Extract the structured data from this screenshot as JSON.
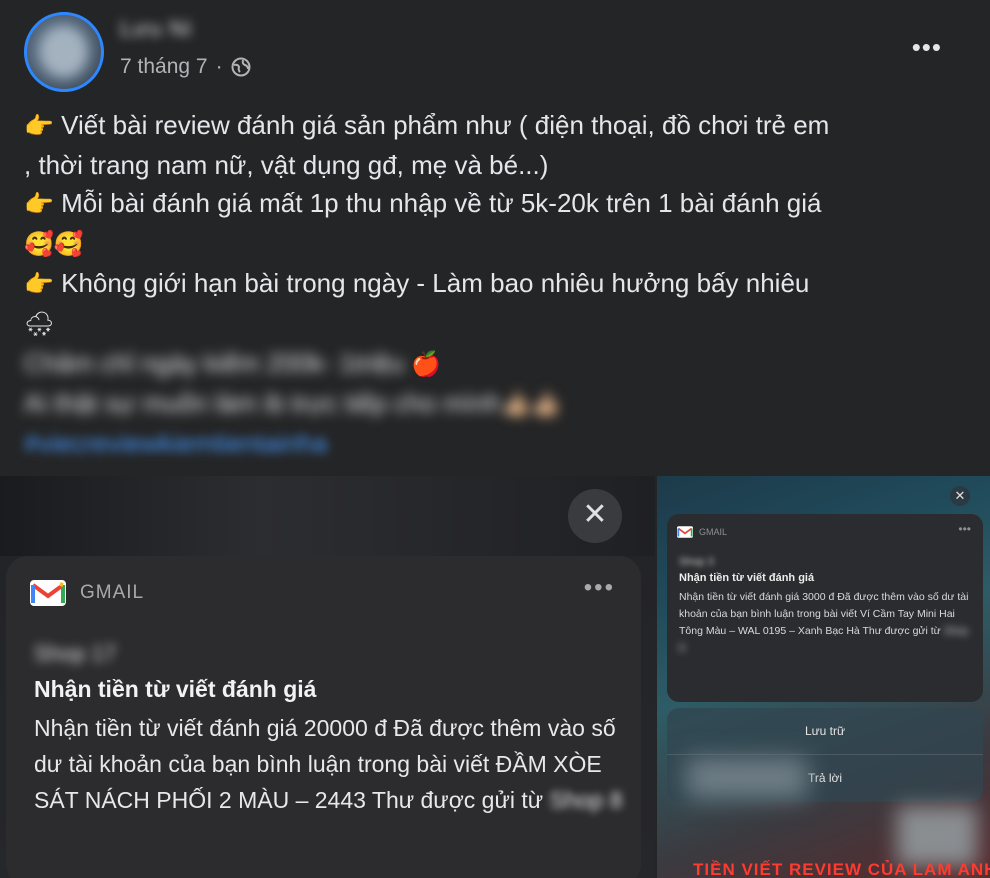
{
  "post": {
    "author_name": "Lưu Ni",
    "date": "7 tháng 7",
    "dot": "·",
    "more_label": "•••",
    "lines": [
      {
        "icon": "👉",
        "text": "Viết bài review đánh giá sản phẩm như ( điện thoại, đồ chơi trẻ em"
      },
      {
        "icon": "",
        "text": ", thời trang nam nữ, vật dụng gđ, mẹ và bé...)"
      },
      {
        "icon": "👉",
        "text": "Mỗi bài đánh giá mất 1p thu nhập về từ 5k-20k trên 1 bài đánh giá"
      },
      {
        "icon": "🥰🥰",
        "text": ""
      },
      {
        "icon": "👉",
        "text": "Không giới hạn bài trong ngày - Làm bao nhiêu hưởng bấy nhiêu"
      },
      {
        "icon": "🌨",
        "text": ""
      }
    ],
    "blurred_line_1": "Chăm chỉ ngày kiếm 200k- 1triệu",
    "blurred_line_1_emoji": "🍎",
    "blurred_line_2": "Ai thật sự muốn làm ib trực tiếp cho mình",
    "blurred_line_2_emoji": "👍🏼👍🏼",
    "hashtag": "#viecreviewkiemtientainha"
  },
  "left_image": {
    "close_label": "✕",
    "app_name": "GMAIL",
    "more_label": "•••",
    "sender": "Shop 17",
    "title": "Nhận tiền từ viết đánh giá",
    "body": "Nhận tiền từ viết đánh giá 20000 đ Đã được thêm vào số dư tài khoản của bạn bình luận trong bài viết ĐẦM XÒE SÁT NÁCH PHỐI 2 MÀU – 2443 Thư được gửi từ",
    "body_blurred_tail": "Shop 8"
  },
  "right_image": {
    "close_label": "✕",
    "app_name": "GMAIL",
    "more_label": "•••",
    "sender": "Shop 3",
    "title": "Nhận tiền từ viết đánh giá",
    "body": "Nhận tiền từ viết đánh giá 3000 đ Đã được thêm vào số dư tài khoản của bạn bình luận trong bài viết Ví Cầm Tay Mini Hai Tông Màu – WAL 0195 – Xanh Bạc Hà Thư được gửi từ",
    "body_blurred_tail": "Shop 8",
    "action_1": "Lưu trữ",
    "action_2": "Trả lời",
    "banner": "TIỀN VIẾT REVIEW CỦA LAM ANH"
  },
  "colors": {
    "background": "#242526",
    "text": "#e4e6eb",
    "secondary_text": "#b0b3b8",
    "hashtag": "#4599ff",
    "banner_red": "#ff3b30"
  }
}
